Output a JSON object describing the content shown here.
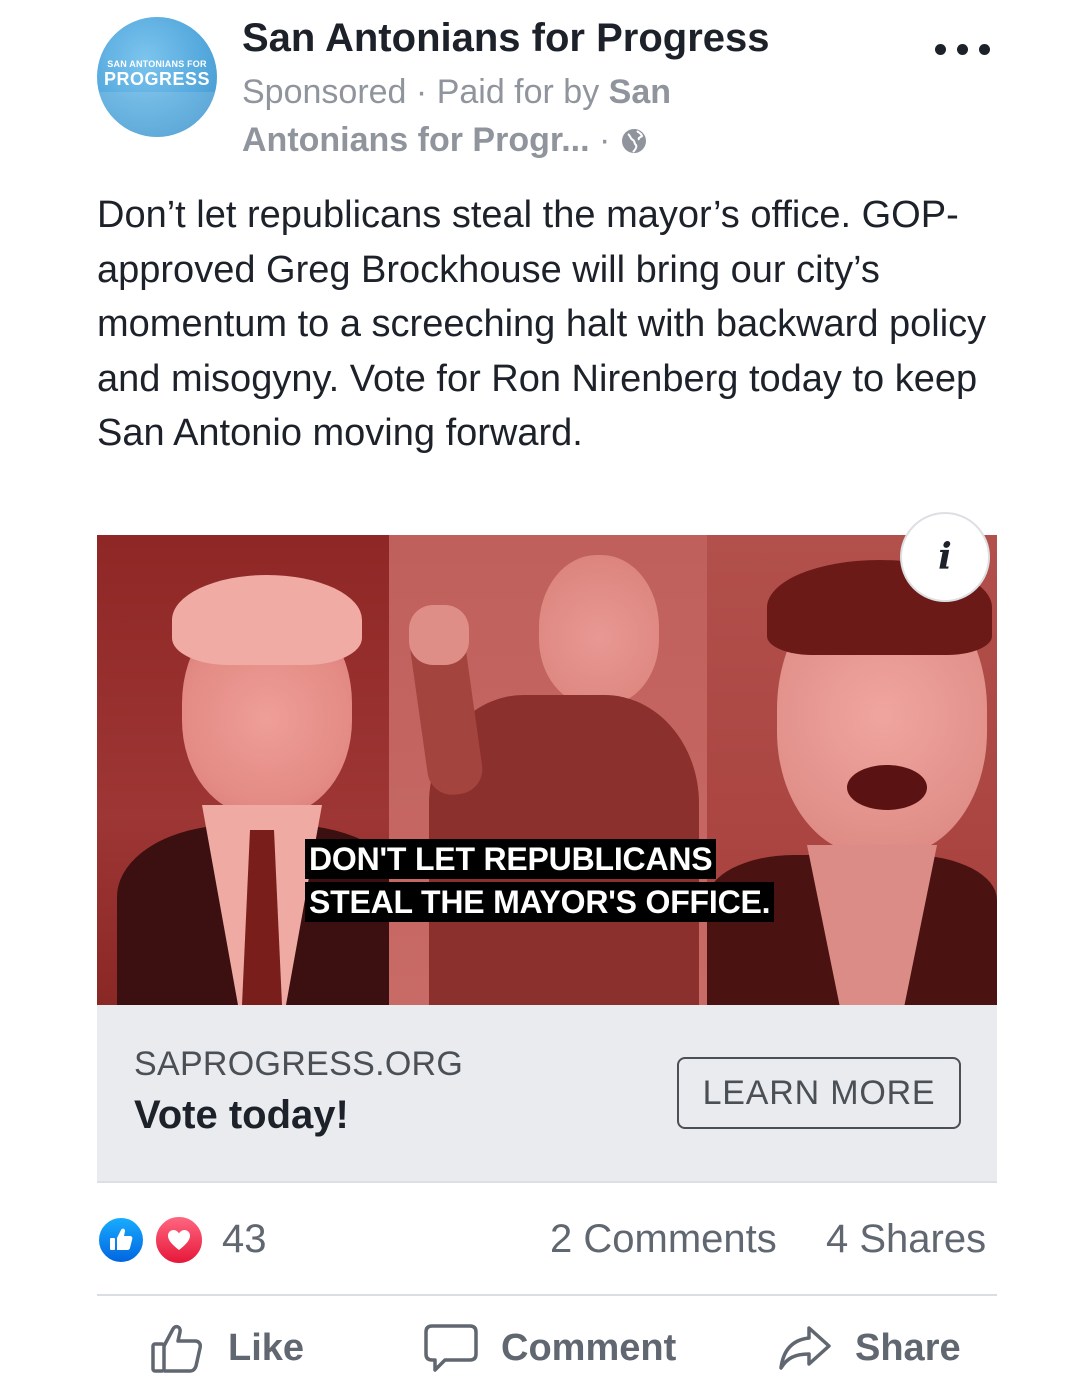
{
  "post": {
    "avatar_line1": "SAN ANTONIANS FOR",
    "avatar_line2": "PROGRESS",
    "page_name": "San Antonians for Progress",
    "sponsored": "Sponsored",
    "dot": " · ",
    "paid_for_by": "Paid for by ",
    "payer_name": "San Antonians for Progr...",
    "body": "Don’t let republicans steal the mayor’s office. GOP-approved Greg Brockhouse will bring our city’s momentum to a screeching halt with backward policy and misogyny. Vote for Ron Nirenberg today to keep San Antonio moving forward."
  },
  "media": {
    "caption_line1": "DON'T LET REPUBLICANS",
    "caption_line2": "STEAL THE MAYOR'S OFFICE.",
    "info_icon": "i"
  },
  "link_card": {
    "domain": "SAPROGRESS.ORG",
    "headline": "Vote today!",
    "cta": "LEARN MORE"
  },
  "stats": {
    "reactions_count": "43",
    "comments": "2 Comments",
    "shares": "4 Shares"
  },
  "actions": {
    "like": "Like",
    "comment": "Comment",
    "share": "Share"
  },
  "colors": {
    "like_blue": "#0165e1",
    "love_red": "#e61739",
    "muted_text": "#90949c",
    "card_bg": "#e9ebee"
  }
}
